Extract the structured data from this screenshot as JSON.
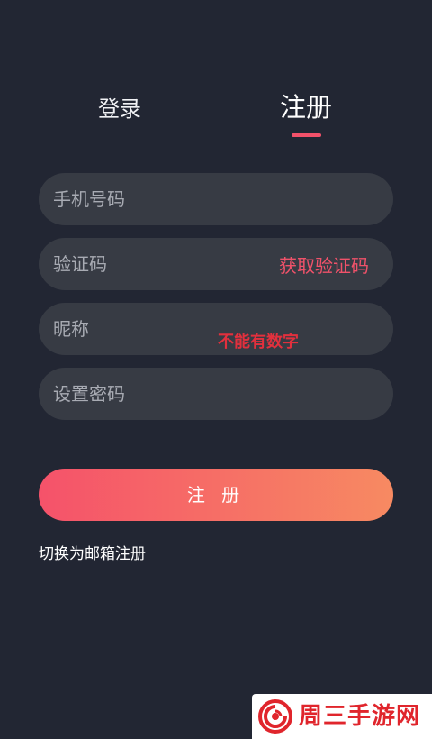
{
  "tabs": {
    "login_label": "登录",
    "register_label": "注册",
    "active": "register"
  },
  "form": {
    "phone_placeholder": "手机号码",
    "code_placeholder": "验证码",
    "get_code_label": "获取验证码",
    "nickname_placeholder": "昵称",
    "nickname_hint": "不能有数字",
    "password_placeholder": "设置密码",
    "submit_label": "注 册"
  },
  "switch_link": "切换为邮箱注册",
  "watermark": {
    "text": "周三手游网"
  },
  "colors": {
    "background": "#222633",
    "field": "#373b44",
    "accent": "#f3516a",
    "hint": "#e2303d",
    "button_gradient_start": "#f5526a",
    "button_gradient_end": "#f78a62"
  }
}
